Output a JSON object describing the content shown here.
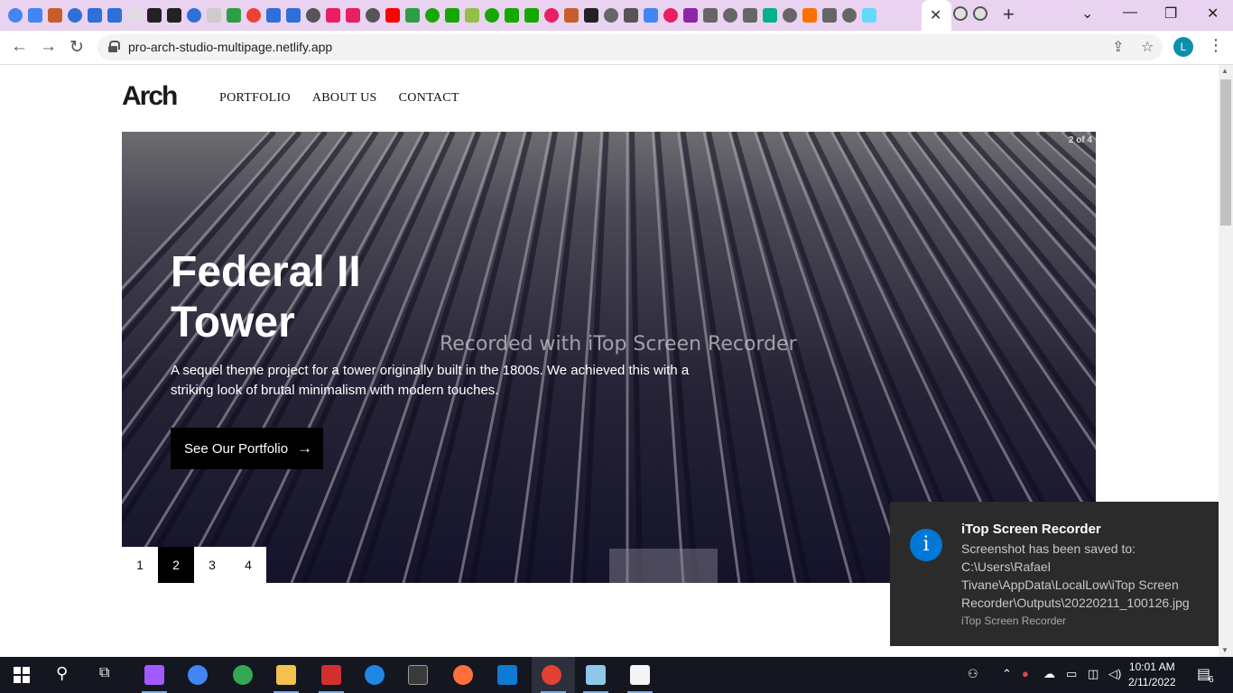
{
  "browser": {
    "url": "pro-arch-studio-multipage.netlify.app",
    "profile_initial": "L",
    "active_tab_close": "✕"
  },
  "site": {
    "logo": "Arch",
    "nav": [
      "PORTFOLIO",
      "ABOUT US",
      "CONTACT"
    ]
  },
  "hero": {
    "counter": "2 of 4",
    "title": "Federal II Tower",
    "description": "A sequel theme project for a tower originally built in the 1800s. We achieved this with a striking look of brutal minimalism with modern touches.",
    "button_label": "See Our Portfolio",
    "watermark": "Recorded with iTop Screen Recorder"
  },
  "pagination": {
    "pages": [
      "1",
      "2",
      "3",
      "4"
    ],
    "active_page": "2"
  },
  "notification": {
    "title": "iTop Screen Recorder",
    "body": "Screenshot has been saved to: C:\\Users\\Rafael Tivane\\AppData\\LocalLow\\iTop Screen Recorder\\Outputs\\20220211_100126.jpg",
    "source": "iTop Screen Recorder"
  },
  "taskbar": {
    "time": "10:01 AM",
    "date": "2/11/2022",
    "notification_count": "6"
  },
  "colors": {
    "tabstrip": "#e9d3f0",
    "accent_profile": "#0d8faa",
    "hero_dark": "#14132a",
    "toast_bg": "#2b2b2b",
    "toast_icon": "#0078d7",
    "taskbar": "#141620"
  }
}
